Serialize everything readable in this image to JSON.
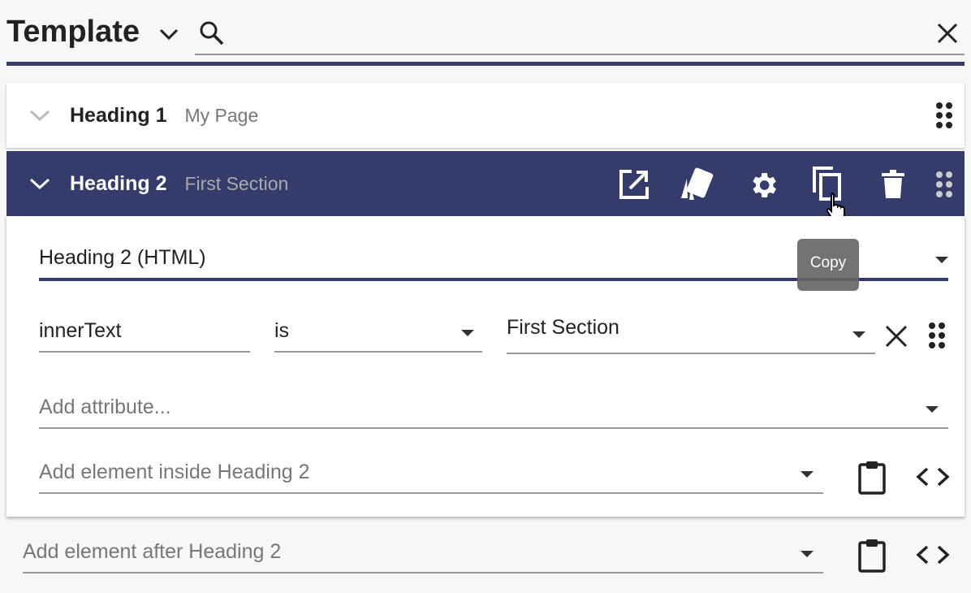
{
  "header": {
    "title": "Template",
    "search_placeholder": ""
  },
  "colors": {
    "accent": "#353c6b",
    "tooltip": "#6b6b6b"
  },
  "rows": [
    {
      "name": "Heading 1",
      "subtitle": "My Page",
      "expanded": false
    },
    {
      "name": "Heading 2",
      "subtitle": "First Section",
      "expanded": true,
      "actions": [
        "open-external-icon",
        "styles-icon",
        "gear-icon",
        "copy-icon",
        "trash-icon",
        "drag-handle-icon"
      ]
    }
  ],
  "panel": {
    "element_type": "Heading 2 (HTML)",
    "attribute": {
      "name": "innerText",
      "operator": "is",
      "value": "First Section"
    },
    "add_attribute_placeholder": "Add attribute...",
    "add_inside_placeholder": "Add element inside Heading 2"
  },
  "tooltip": "Copy",
  "add_after_placeholder": "Add element after Heading 2"
}
